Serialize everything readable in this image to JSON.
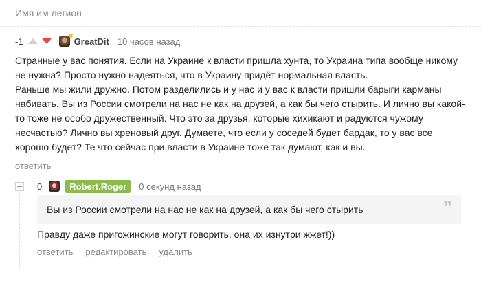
{
  "group": {
    "title": "Имя им легион"
  },
  "comment": {
    "rating": "-1",
    "username": "GreatDit",
    "time": "10 часов назад",
    "body": [
      "Странные у вас понятия. Если на Украине к власти пришла хунта, то Украина типа вообще никому не нужна? Просто нужно надеяться, что в Украину придёт нормальная власть.",
      "Раньше мы жили дружно. Потом разделились и у нас и у вас к власти пришли барыги карманы набивать. Вы из России смотрели на нас не как на друзей, а как бы чего стырить. И лично вы какой-то тоже не особо дружественный. Что это за друзья, которые хихикают и радуются чужому несчастью? Лично вы хреновый друг. Думаете, что если у соседей будет бардак, то у вас все хорошо будет? Те что сейчас при власти в Украине тоже так думают, как и вы."
    ],
    "reply_label": "ответить"
  },
  "reply": {
    "rating": "0",
    "username": "Robert.Roger",
    "time": "0 секунд назад",
    "quote": "Вы из России смотрели на нас не как на друзей, а как бы чего стырить",
    "quote_mark": "❞",
    "text": "Правду даже пригожинские могут говорить, она их изнутри жжет!))",
    "actions": {
      "reply": "ответить",
      "edit": "редактировать",
      "delete": "удалить"
    },
    "badge_color": "#8bbb4a"
  }
}
